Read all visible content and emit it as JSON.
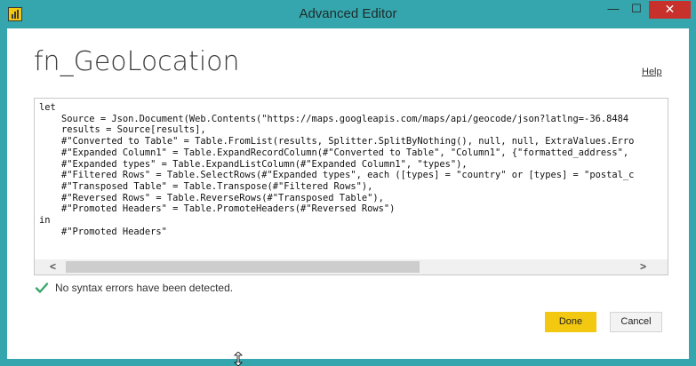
{
  "window": {
    "title": "Advanced Editor",
    "minimize_glyph": "—",
    "maximize_glyph": "☐",
    "close_glyph": "✕"
  },
  "query": {
    "name": "fn_GeoLocation"
  },
  "help": {
    "label": "Help"
  },
  "editor": {
    "lines": [
      "let",
      "    Source = Json.Document(Web.Contents(\"https://maps.googleapis.com/maps/api/geocode/json?latlng=-36.8484",
      "    results = Source[results],",
      "    #\"Converted to Table\" = Table.FromList(results, Splitter.SplitByNothing(), null, null, ExtraValues.Erro",
      "    #\"Expanded Column1\" = Table.ExpandRecordColumn(#\"Converted to Table\", \"Column1\", {\"formatted_address\",",
      "    #\"Expanded types\" = Table.ExpandListColumn(#\"Expanded Column1\", \"types\"),",
      "    #\"Filtered Rows\" = Table.SelectRows(#\"Expanded types\", each ([types] = \"country\" or [types] = \"postal_c",
      "    #\"Transposed Table\" = Table.Transpose(#\"Filtered Rows\"),",
      "    #\"Reversed Rows\" = Table.ReverseRows(#\"Transposed Table\"),",
      "    #\"Promoted Headers\" = Table.PromoteHeaders(#\"Reversed Rows\")",
      "in",
      "    #\"Promoted Headers\""
    ],
    "scroll_left_glyph": "<",
    "scroll_right_glyph": ">"
  },
  "status": {
    "message": "No syntax errors have been detected.",
    "icon": "check-icon",
    "color": "#3aa66a"
  },
  "buttons": {
    "done": "Done",
    "cancel": "Cancel"
  },
  "colors": {
    "frame": "#35a6ad",
    "done_button": "#f2c811",
    "close_button": "#c7302b"
  }
}
